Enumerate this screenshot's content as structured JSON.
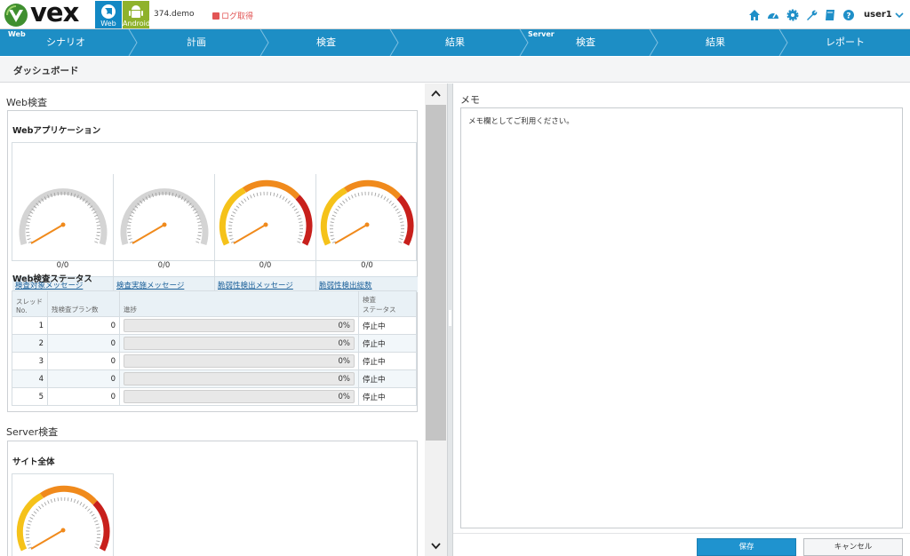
{
  "header": {
    "logo_text": "vex",
    "modes": [
      {
        "label": "Web"
      },
      {
        "label": "Android"
      }
    ],
    "hostname": "374.demo",
    "log_capture": "ログ取得",
    "username": "user1",
    "icons": [
      "home-icon",
      "dashboard-icon",
      "settings-gear-icon",
      "wrench-icon",
      "book-icon",
      "help-icon"
    ]
  },
  "nav": {
    "groups": {
      "web": "Web",
      "server": "Server"
    },
    "steps": [
      {
        "label": "シナリオ"
      },
      {
        "label": "計画"
      },
      {
        "label": "検査"
      },
      {
        "label": "結果"
      },
      {
        "label": "検査"
      },
      {
        "label": "結果"
      },
      {
        "label": "レポート"
      }
    ]
  },
  "page": {
    "title": "ダッシュボード"
  },
  "web_section": {
    "title": "Web検査",
    "app_title": "Webアプリケーション",
    "gauges": [
      {
        "value": "0/0",
        "label": "検査対象メッセージ",
        "style": "gray"
      },
      {
        "value": "0/0",
        "label": "検査実施メッセージ",
        "style": "gray"
      },
      {
        "value": "0/0",
        "label": "脆弱性検出メッセージ",
        "style": "color"
      },
      {
        "value": "0/0",
        "label": "脆弱性検出総数",
        "style": "color"
      }
    ],
    "status_title": "Web検査ステータス",
    "table": {
      "headers": [
        "スレッド\nNo.",
        "残検査プラン数",
        "進捗",
        "検査\nステータス"
      ],
      "rows": [
        {
          "no": "1",
          "remaining": "0",
          "progress": "0%",
          "status": "停止中"
        },
        {
          "no": "2",
          "remaining": "0",
          "progress": "0%",
          "status": "停止中"
        },
        {
          "no": "3",
          "remaining": "0",
          "progress": "0%",
          "status": "停止中"
        },
        {
          "no": "4",
          "remaining": "0",
          "progress": "0%",
          "status": "停止中"
        },
        {
          "no": "5",
          "remaining": "0",
          "progress": "0%",
          "status": "停止中"
        }
      ]
    }
  },
  "server_section": {
    "title": "Server検査",
    "site_title": "サイト全体"
  },
  "memo": {
    "title": "メモ",
    "placeholder": "メモ欄としてご利用ください。"
  },
  "buttons": {
    "save": "保存",
    "cancel": "キャンセル"
  },
  "colors": {
    "nav": "#1d8ec5",
    "web_mode": "#1288c4",
    "android_mode": "#8fb22c",
    "gauge_red": "#c8201c",
    "gauge_orange": "#f08a1c",
    "gauge_yellow": "#f5c21a"
  }
}
